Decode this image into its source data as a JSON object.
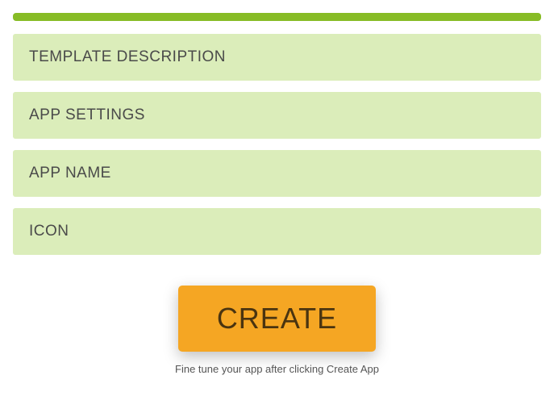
{
  "colors": {
    "accent_bar": "#87bc26",
    "section_bg": "#dbedba",
    "button_bg": "#f5a623",
    "button_text": "#4a3410",
    "section_text": "#4a4a4a"
  },
  "sections": [
    {
      "label": "TEMPLATE DESCRIPTION"
    },
    {
      "label": "APP SETTINGS"
    },
    {
      "label": "APP NAME"
    },
    {
      "label": "ICON"
    }
  ],
  "create_button": {
    "label": "CREATE"
  },
  "hint": "Fine tune your app after clicking Create App"
}
